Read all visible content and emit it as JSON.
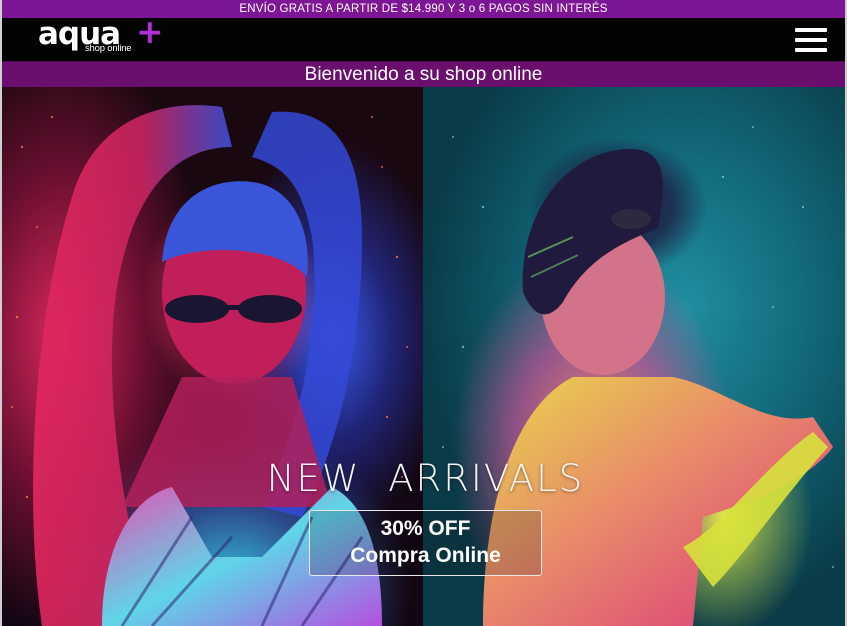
{
  "promo": {
    "text": "ENVÍO GRATIS A PARTIR DE $14.990 Y 3 o 6 PAGOS SIN INTERÉS"
  },
  "header": {
    "logo_word": "aqua",
    "logo_plus": "+",
    "logo_sub": "shop online",
    "menu_icon": "hamburger-menu-icon"
  },
  "welcome": {
    "text": "Bienvenido a su shop online"
  },
  "hero": {
    "headline": "NEW  ARRIVALS",
    "cta_line1": "30% OFF",
    "cta_line2": "Compra Online"
  },
  "colors": {
    "promo_bg": "#7d1694",
    "header_bg": "#030303",
    "welcome_bg": "#6a0f6d",
    "accent_plus": "#b12fd6"
  }
}
